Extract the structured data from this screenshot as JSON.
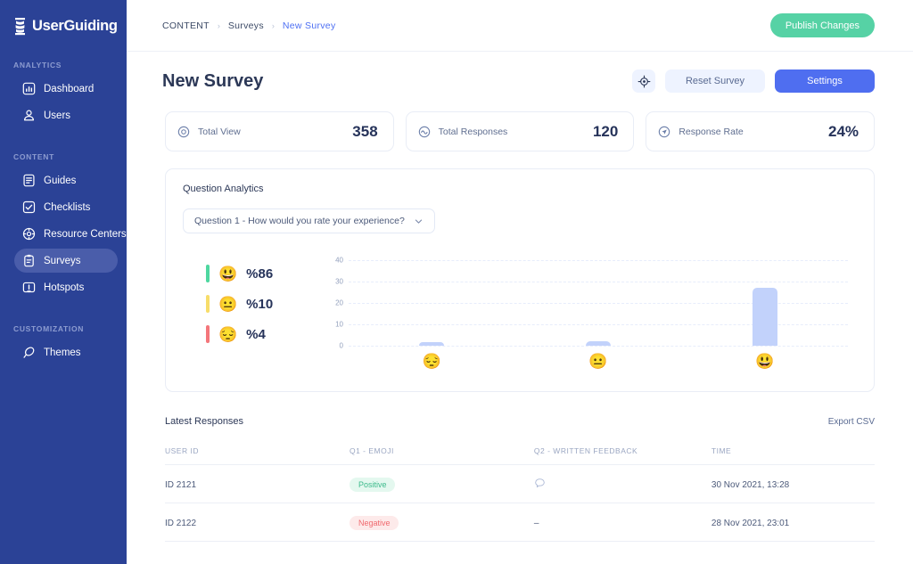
{
  "brand": {
    "name": "UserGuiding",
    "logo_icon": "userguiding-logo-icon",
    "sidebar_bg": "#2b4296",
    "accent_blue": "#4f6ef0",
    "accent_green": "#56d2a5"
  },
  "sidebar": {
    "sections": [
      {
        "label": "ANALYTICS",
        "items": [
          {
            "label": "Dashboard",
            "icon": "dashboard-icon",
            "active": false
          },
          {
            "label": "Users",
            "icon": "users-icon",
            "active": false
          }
        ]
      },
      {
        "label": "CONTENT",
        "items": [
          {
            "label": "Guides",
            "icon": "guides-icon",
            "active": false
          },
          {
            "label": "Checklists",
            "icon": "checklists-icon",
            "active": false
          },
          {
            "label": "Resource Centers",
            "icon": "resource-centers-icon",
            "active": false
          },
          {
            "label": "Surveys",
            "icon": "surveys-icon",
            "active": true
          },
          {
            "label": "Hotspots",
            "icon": "hotspots-icon",
            "active": false
          }
        ]
      },
      {
        "label": "CUSTOMIZATION",
        "items": [
          {
            "label": "Themes",
            "icon": "themes-icon",
            "active": false
          }
        ]
      }
    ]
  },
  "topbar": {
    "breadcrumb": [
      {
        "label": "CONTENT"
      },
      {
        "label": "Surveys"
      },
      {
        "label": "New Survey"
      }
    ],
    "separator": "›",
    "publish_label": "Publish Changes"
  },
  "header": {
    "title": "New Survey",
    "target_icon": "crosshair-target-icon",
    "reset_label": "Reset Survey",
    "settings_label": "Settings"
  },
  "stats": [
    {
      "label": "Total View",
      "value": "358",
      "icon": "eye-circle-icon"
    },
    {
      "label": "Total Responses",
      "value": "120",
      "icon": "activity-circle-icon"
    },
    {
      "label": "Response Rate",
      "value": "24%",
      "icon": "navigation-circle-icon"
    }
  ],
  "question_analytics": {
    "title": "Question Analytics",
    "selected_question": "Question 1 - How would you rate your experience?",
    "dropdown_icon": "chevron-down-icon",
    "legend": [
      {
        "emoji": "😃",
        "percent": "%86",
        "color": "#4ed7a0"
      },
      {
        "emoji": "😐",
        "percent": "%10",
        "color": "#f7dd6a"
      },
      {
        "emoji": "😔",
        "percent": "%4",
        "color": "#f4767b"
      }
    ]
  },
  "chart_data": {
    "type": "bar",
    "title": "Question Analytics",
    "categories": [
      "😔",
      "😐",
      "😃"
    ],
    "category_names": [
      "Pensive",
      "Neutral",
      "Grinning"
    ],
    "values": [
      1,
      2,
      27
    ],
    "percentages": [
      "%4",
      "%10",
      "%86"
    ],
    "yticks": [
      0,
      10,
      20,
      30,
      40
    ],
    "ylim": [
      0,
      40
    ],
    "xlabel": "",
    "ylabel": "",
    "grid": true,
    "grid_style": "dashed",
    "bar_color": "#c2d2fb",
    "legend_position": "left"
  },
  "latest_responses": {
    "title": "Latest Responses",
    "export_label": "Export CSV",
    "columns": [
      "USER ID",
      "Q1 - EMOJI",
      "Q2 - WRITTEN FEEDBACK",
      "TIME"
    ],
    "rows": [
      {
        "user_id": "ID 2121",
        "emoji_badge": "Positive",
        "badge_type": "positive",
        "feedback": "",
        "feedback_icon": "speech-bubble-icon",
        "time": "30 Nov 2021, 13:28"
      },
      {
        "user_id": "ID 2122",
        "emoji_badge": "Negative",
        "badge_type": "negative",
        "feedback": "–",
        "feedback_icon": "",
        "time": "28 Nov 2021, 23:01"
      }
    ]
  }
}
